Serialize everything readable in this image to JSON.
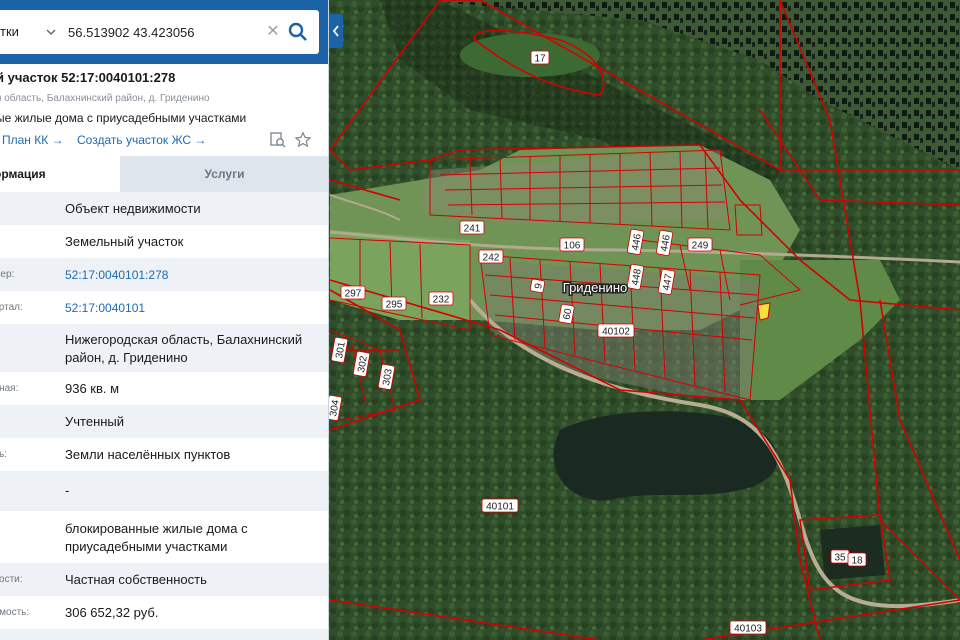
{
  "search": {
    "type_label": "тки",
    "query": "56.513902 43.423056"
  },
  "object": {
    "title": "й участок 52:17:0040101:278",
    "address": "я область, Балахнинский район, д. Гриденино",
    "use_short": "ые жилые дома с приусадебными участками",
    "link_plan": "План КК →",
    "link_create": "Создать участок ЖС →"
  },
  "tabs": {
    "info": "ормация",
    "services": "Услуги"
  },
  "rows": [
    {
      "key": "",
      "value": "Объект недвижимости"
    },
    {
      "key": "",
      "value": "Земельный участок"
    },
    {
      "key": "омер:",
      "value": "52:17:0040101:278"
    },
    {
      "key": "вартал:",
      "value": "52:17:0040101"
    },
    {
      "key": "",
      "value": "Нижегородская область, Балахнинский район, д. Гриденино"
    },
    {
      "key": "енная:",
      "value": "936 кв. м"
    },
    {
      "key": "",
      "value": "Учтенный"
    },
    {
      "key": "ель:",
      "value": "Земли населённых пунктов"
    },
    {
      "key": ":",
      "value": "-"
    },
    {
      "key": "",
      "value": "блокированные жилые дома с приусадебными участками"
    },
    {
      "key": "нности:",
      "value": "Частная собственность"
    },
    {
      "key": "оимость:",
      "value": "306 652,32 руб."
    }
  ],
  "map": {
    "village_label": "Гриденино",
    "parcel_labels": [
      "17",
      "241",
      "106",
      "446",
      "446",
      "249",
      "242",
      "448",
      "447",
      "297",
      "295",
      "232",
      "9",
      "60",
      "40102",
      "301",
      "302",
      "303",
      "304",
      "40101",
      "35",
      "18",
      "40103"
    ],
    "colors": {
      "boundary": "#d40000",
      "highlight": "#f4e23a",
      "forest": "#2c4a26",
      "field": "#5d8a45",
      "water": "#1c2e26",
      "panel_header": "#1b62a6",
      "link": "#1d6bb5"
    }
  }
}
